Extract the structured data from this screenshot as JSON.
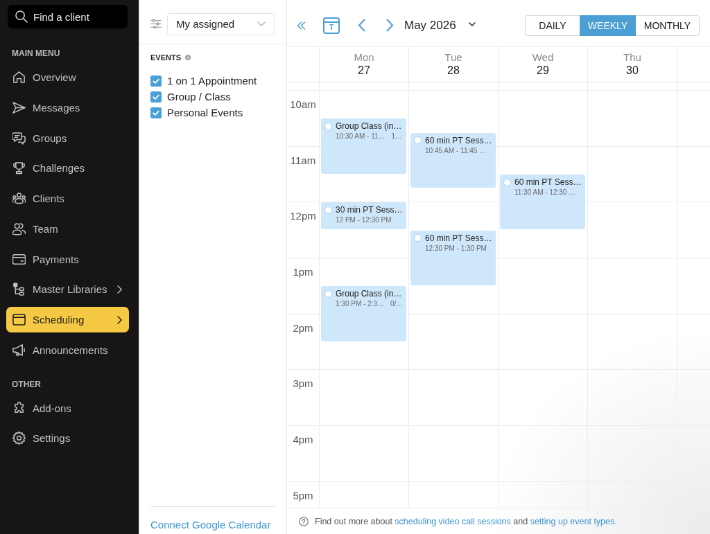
{
  "sidebar": {
    "search": {
      "placeholder": "Find a client"
    },
    "sections": [
      {
        "title": "MAIN MENU",
        "items": [
          {
            "label": "Overview",
            "selected": false,
            "expandable": false
          },
          {
            "label": "Messages",
            "selected": false,
            "expandable": false
          },
          {
            "label": "Groups",
            "selected": false,
            "expandable": false
          },
          {
            "label": "Challenges",
            "selected": false,
            "expandable": false
          },
          {
            "label": "Clients",
            "selected": false,
            "expandable": false
          },
          {
            "label": "Team",
            "selected": false,
            "expandable": false
          },
          {
            "label": "Payments",
            "selected": false,
            "expandable": false
          },
          {
            "label": "Master Libraries",
            "selected": false,
            "expandable": true
          },
          {
            "label": "Scheduling",
            "selected": true,
            "expandable": true
          },
          {
            "label": "Announcements",
            "selected": false,
            "expandable": false
          }
        ]
      },
      {
        "title": "OTHER",
        "items": [
          {
            "label": "Add-ons",
            "selected": false,
            "expandable": false
          },
          {
            "label": "Settings",
            "selected": false,
            "expandable": false
          }
        ]
      }
    ]
  },
  "filters": {
    "assignee": {
      "value": "My assigned"
    },
    "events_title": "EVENTS",
    "event_types": [
      {
        "label": "1 on 1 Appointment",
        "checked": true
      },
      {
        "label": "Group / Class",
        "checked": true
      },
      {
        "label": "Personal Events",
        "checked": true
      }
    ],
    "connect_link": "Connect Google Calendar"
  },
  "calendar": {
    "today_button": "T",
    "month": "May 2026",
    "views": [
      {
        "label": "DAILY",
        "selected": false
      },
      {
        "label": "WEEKLY",
        "selected": true
      },
      {
        "label": "MONTHLY",
        "selected": false
      }
    ],
    "days": [
      {
        "name": "Mon",
        "date": "27",
        "events": [
          {
            "kind": "long",
            "title": "Group Class (in…",
            "time": "10:30 AM - 11…",
            "count": "1…"
          },
          {
            "kind": "short",
            "title": "30 min PT Sess…",
            "time": "12 PM - 12:30 PM"
          },
          {
            "kind": "long",
            "title": "Group Class (in…",
            "time": "1:30 PM - 2:3…",
            "count": "0/…"
          }
        ]
      },
      {
        "name": "Tue",
        "date": "28",
        "events": [
          {
            "kind": "long",
            "title": "60 min PT Sess…",
            "time": "10:45 AM - 11:45 …"
          },
          {
            "kind": "long",
            "title": "60 min PT Sess…",
            "time": "12:30 PM - 1:30 PM"
          }
        ]
      },
      {
        "name": "Wed",
        "date": "29",
        "events": [
          {
            "kind": "long",
            "title": "60 min PT Sess…",
            "time": "11:30 AM - 12:30 …"
          }
        ]
      },
      {
        "name": "Thu",
        "date": "30"
      }
    ],
    "hours": [
      "10am",
      "11am",
      "12pm",
      "1pm",
      "2pm",
      "3pm",
      "4pm",
      "5pm"
    ]
  },
  "help": {
    "parts": [
      {
        "kind": "text",
        "text": "Find out more about"
      },
      {
        "kind": "link",
        "text": "scheduling video call sessions"
      },
      {
        "kind": "text",
        "text": "and"
      },
      {
        "kind": "link",
        "text": "setting up event types."
      }
    ]
  }
}
